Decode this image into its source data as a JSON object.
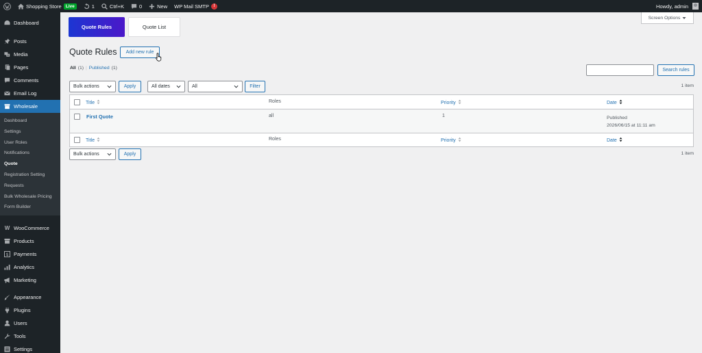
{
  "adminbar": {
    "site_name": "Shopping Store",
    "live_badge": "Live",
    "updates_count": "1",
    "shortcut": "Ctrl+K",
    "comments_count": "0",
    "new_label": "New",
    "smtp_label": "WP Mail SMTP",
    "smtp_badge": "!",
    "howdy": "Howdy, admin"
  },
  "sidebar": {
    "items_top": [
      {
        "label": "Dashboard",
        "icon": "dashboard-icon"
      },
      {
        "label": "Posts",
        "icon": "pin-icon"
      },
      {
        "label": "Media",
        "icon": "media-icon"
      },
      {
        "label": "Pages",
        "icon": "page-icon"
      },
      {
        "label": "Comments",
        "icon": "comment-icon"
      },
      {
        "label": "Email Log",
        "icon": "email-icon"
      },
      {
        "label": "Wholesale",
        "icon": "store-icon"
      }
    ],
    "submenu": [
      "Dashboard",
      "Settings",
      "User Roles",
      "Notifications",
      "Quote",
      "Registration Setting",
      "Requests",
      "Bulk Wholesale Pricing",
      "Form Builder"
    ],
    "items_mid": [
      {
        "label": "WooCommerce",
        "icon": "woo-icon"
      },
      {
        "label": "Products",
        "icon": "archive-icon"
      },
      {
        "label": "Payments",
        "icon": "dollar-icon"
      },
      {
        "label": "Analytics",
        "icon": "chart-icon"
      },
      {
        "label": "Marketing",
        "icon": "megaphone-icon"
      }
    ],
    "items_bottom": [
      {
        "label": "Appearance",
        "icon": "brush-icon"
      },
      {
        "label": "Plugins",
        "icon": "plugin-icon"
      },
      {
        "label": "Users",
        "icon": "user-icon"
      },
      {
        "label": "Tools",
        "icon": "wrench-icon"
      },
      {
        "label": "Settings",
        "icon": "settings-icon"
      }
    ]
  },
  "tabs": {
    "quote_rules": "Quote Rules",
    "quote_list": "Quote List"
  },
  "screen_options": "Screen Options",
  "page": {
    "title": "Quote Rules",
    "add_new": "Add new rule",
    "filter_all": "All",
    "filter_all_count": "(1)",
    "filter_sep": "|",
    "filter_published": "Published",
    "filter_published_count": "(1)",
    "search_button": "Search rules",
    "search_placeholder": ""
  },
  "toolbar": {
    "bulk_actions": "Bulk actions",
    "apply": "Apply",
    "dates": "All dates",
    "all": "All",
    "filter": "Filter",
    "item_count": "1 item"
  },
  "table": {
    "columns": {
      "title": "Title",
      "roles": "Roles",
      "priority": "Priority",
      "date": "Date"
    },
    "rows": [
      {
        "title": "First Quote",
        "roles": "all",
        "priority": "1",
        "status": "Published",
        "date": "2026/06/15 at 11:11 am"
      }
    ]
  },
  "colors": {
    "accent": "#2271b1",
    "adminbar": "#1d2327",
    "tab_gradient_start": "#1c36d2",
    "tab_gradient_end": "#4b18c9"
  }
}
